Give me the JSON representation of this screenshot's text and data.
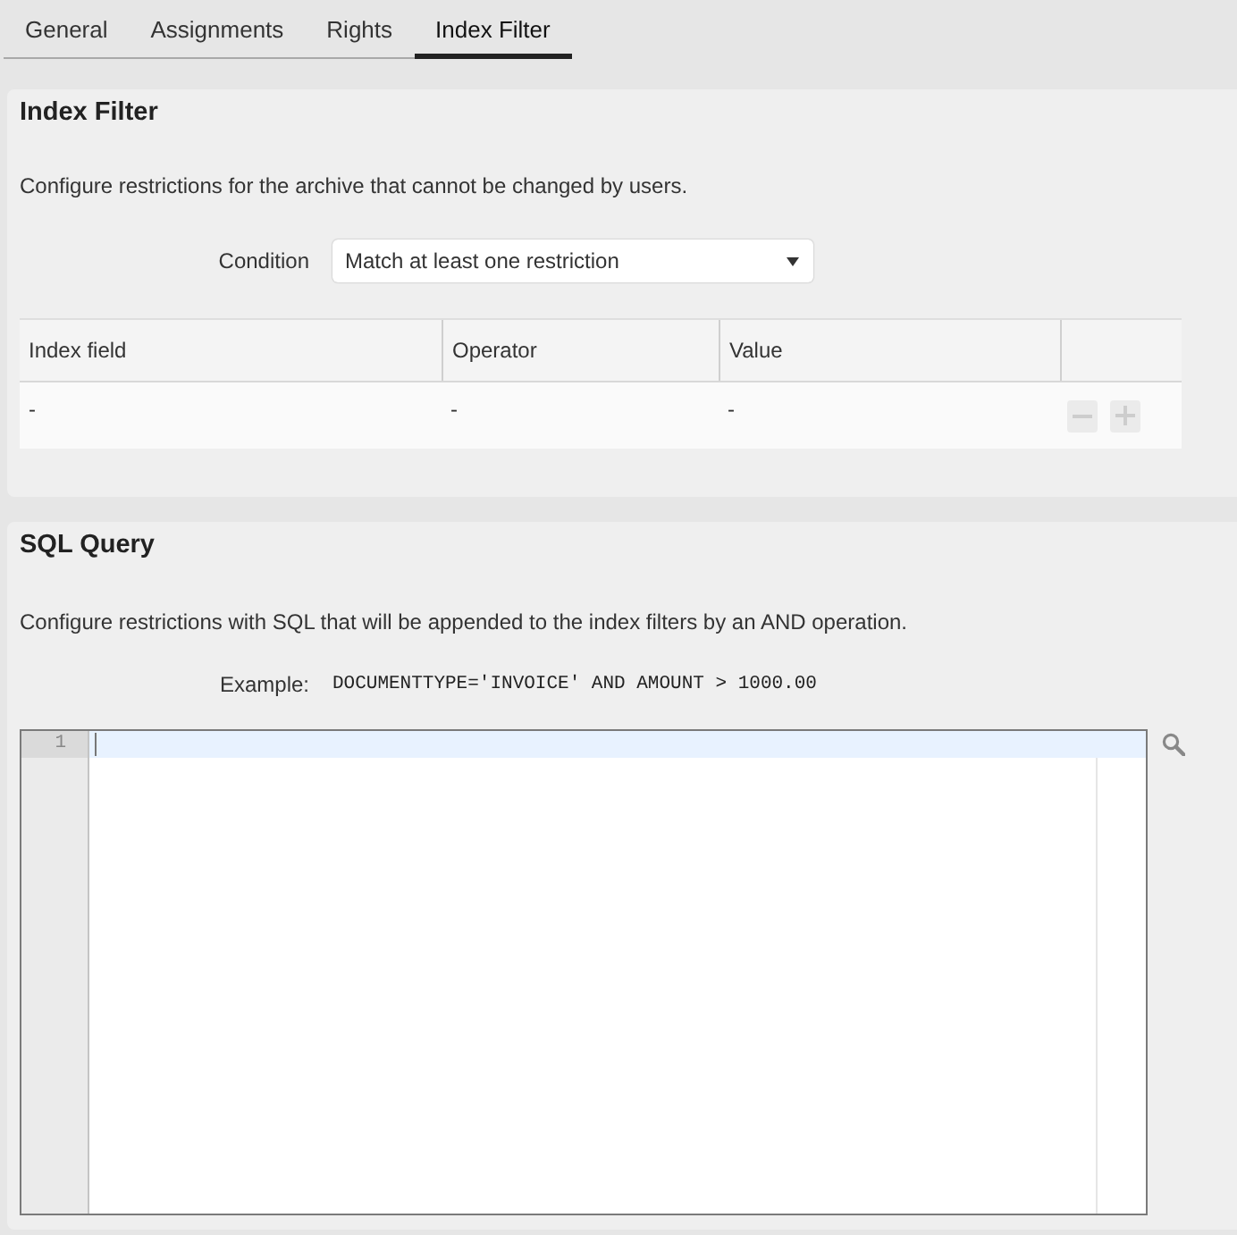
{
  "tabs": [
    {
      "label": "General",
      "selected": false
    },
    {
      "label": "Assignments",
      "selected": false
    },
    {
      "label": "Rights",
      "selected": false
    },
    {
      "label": "Index Filter",
      "selected": true
    }
  ],
  "index_filter": {
    "title": "Index Filter",
    "description": "Configure restrictions for the archive that cannot be changed by users.",
    "condition": {
      "label": "Condition",
      "value": "Match at least one restriction"
    },
    "table": {
      "columns": [
        "Index field",
        "Operator",
        "Value"
      ],
      "rows": [
        {
          "cells": [
            "-",
            "-",
            "-"
          ],
          "actions": [
            {
              "kind": "remove",
              "disabled": true
            },
            {
              "kind": "add",
              "disabled": true
            }
          ]
        }
      ]
    }
  },
  "sql_query": {
    "title": "SQL Query",
    "description": "Configure restrictions with SQL that will be appended to the index filters by an AND operation.",
    "example": {
      "label": "Example:",
      "code": "DOCUMENTTYPE='INVOICE' AND AMOUNT > 1000.00"
    },
    "editor": {
      "lines": [
        {
          "number": "1",
          "active": true
        }
      ]
    }
  }
}
